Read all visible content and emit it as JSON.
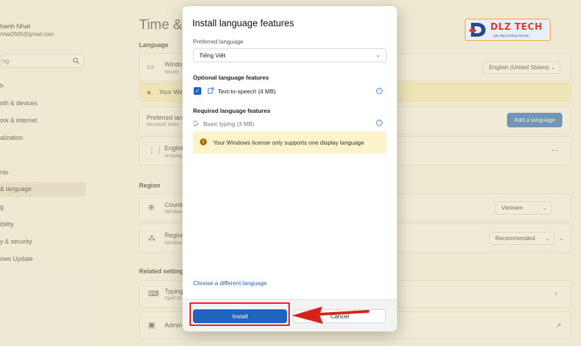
{
  "profile": {
    "name": "hanh Nhat",
    "email": "nhat2605@gmail.com"
  },
  "search": {
    "placeholder": "ng"
  },
  "nav": [
    {
      "label": "h"
    },
    {
      "label": "oth & devices"
    },
    {
      "label": "ork & internet"
    },
    {
      "label": "alization"
    },
    {
      "label": "nts"
    },
    {
      "label": "& language"
    },
    {
      "label": "g"
    },
    {
      "label": "ibility"
    },
    {
      "label": "y & security"
    },
    {
      "label": "ows Update"
    }
  ],
  "page": {
    "title": "Time & l",
    "language_section": "Language",
    "windows_display": {
      "title": "Windo",
      "sub": "Windo",
      "value": "English (United States)"
    },
    "warning_banner": "Your Win",
    "preferred": {
      "title": "Preferred lang",
      "sub": "Microsoft Store",
      "add_button": "Add a language"
    },
    "english": {
      "title": "English",
      "sub": "languag",
      "more": "..."
    },
    "region_section": "Region",
    "country": {
      "title": "Countr",
      "sub": "Window",
      "value": "Vietnam"
    },
    "regional_format": {
      "title": "Region",
      "sub": "Window",
      "value": "Recommended"
    },
    "related_section": "Related settings",
    "typing": {
      "title": "Typing",
      "sub": "Spell ch"
    },
    "admin": {
      "title": "Admin"
    }
  },
  "dialog": {
    "title": "Install language features",
    "preferred_label": "Preferred language",
    "preferred_value": "Tiếng Việt",
    "optional_heading": "Optional language features",
    "optional_feature": "Text-to-speech (4 MB)",
    "optional_checked": true,
    "required_heading": "Required language features",
    "required_feature": "Basic typing (3 MB)",
    "warning": "Your Windows license only supports one display language",
    "link": "Choose a different language",
    "install_label": "Install",
    "cancel_label": "Cancel"
  },
  "logo": {
    "text": "DLZ TECH",
    "tagline": "Làm đẹp ý tưởng của bạn"
  },
  "colors": {
    "accent": "#1f64bf",
    "annotation": "#d7221c",
    "warning_bg": "#fcf2cc",
    "logo_red": "#e03a2a"
  }
}
